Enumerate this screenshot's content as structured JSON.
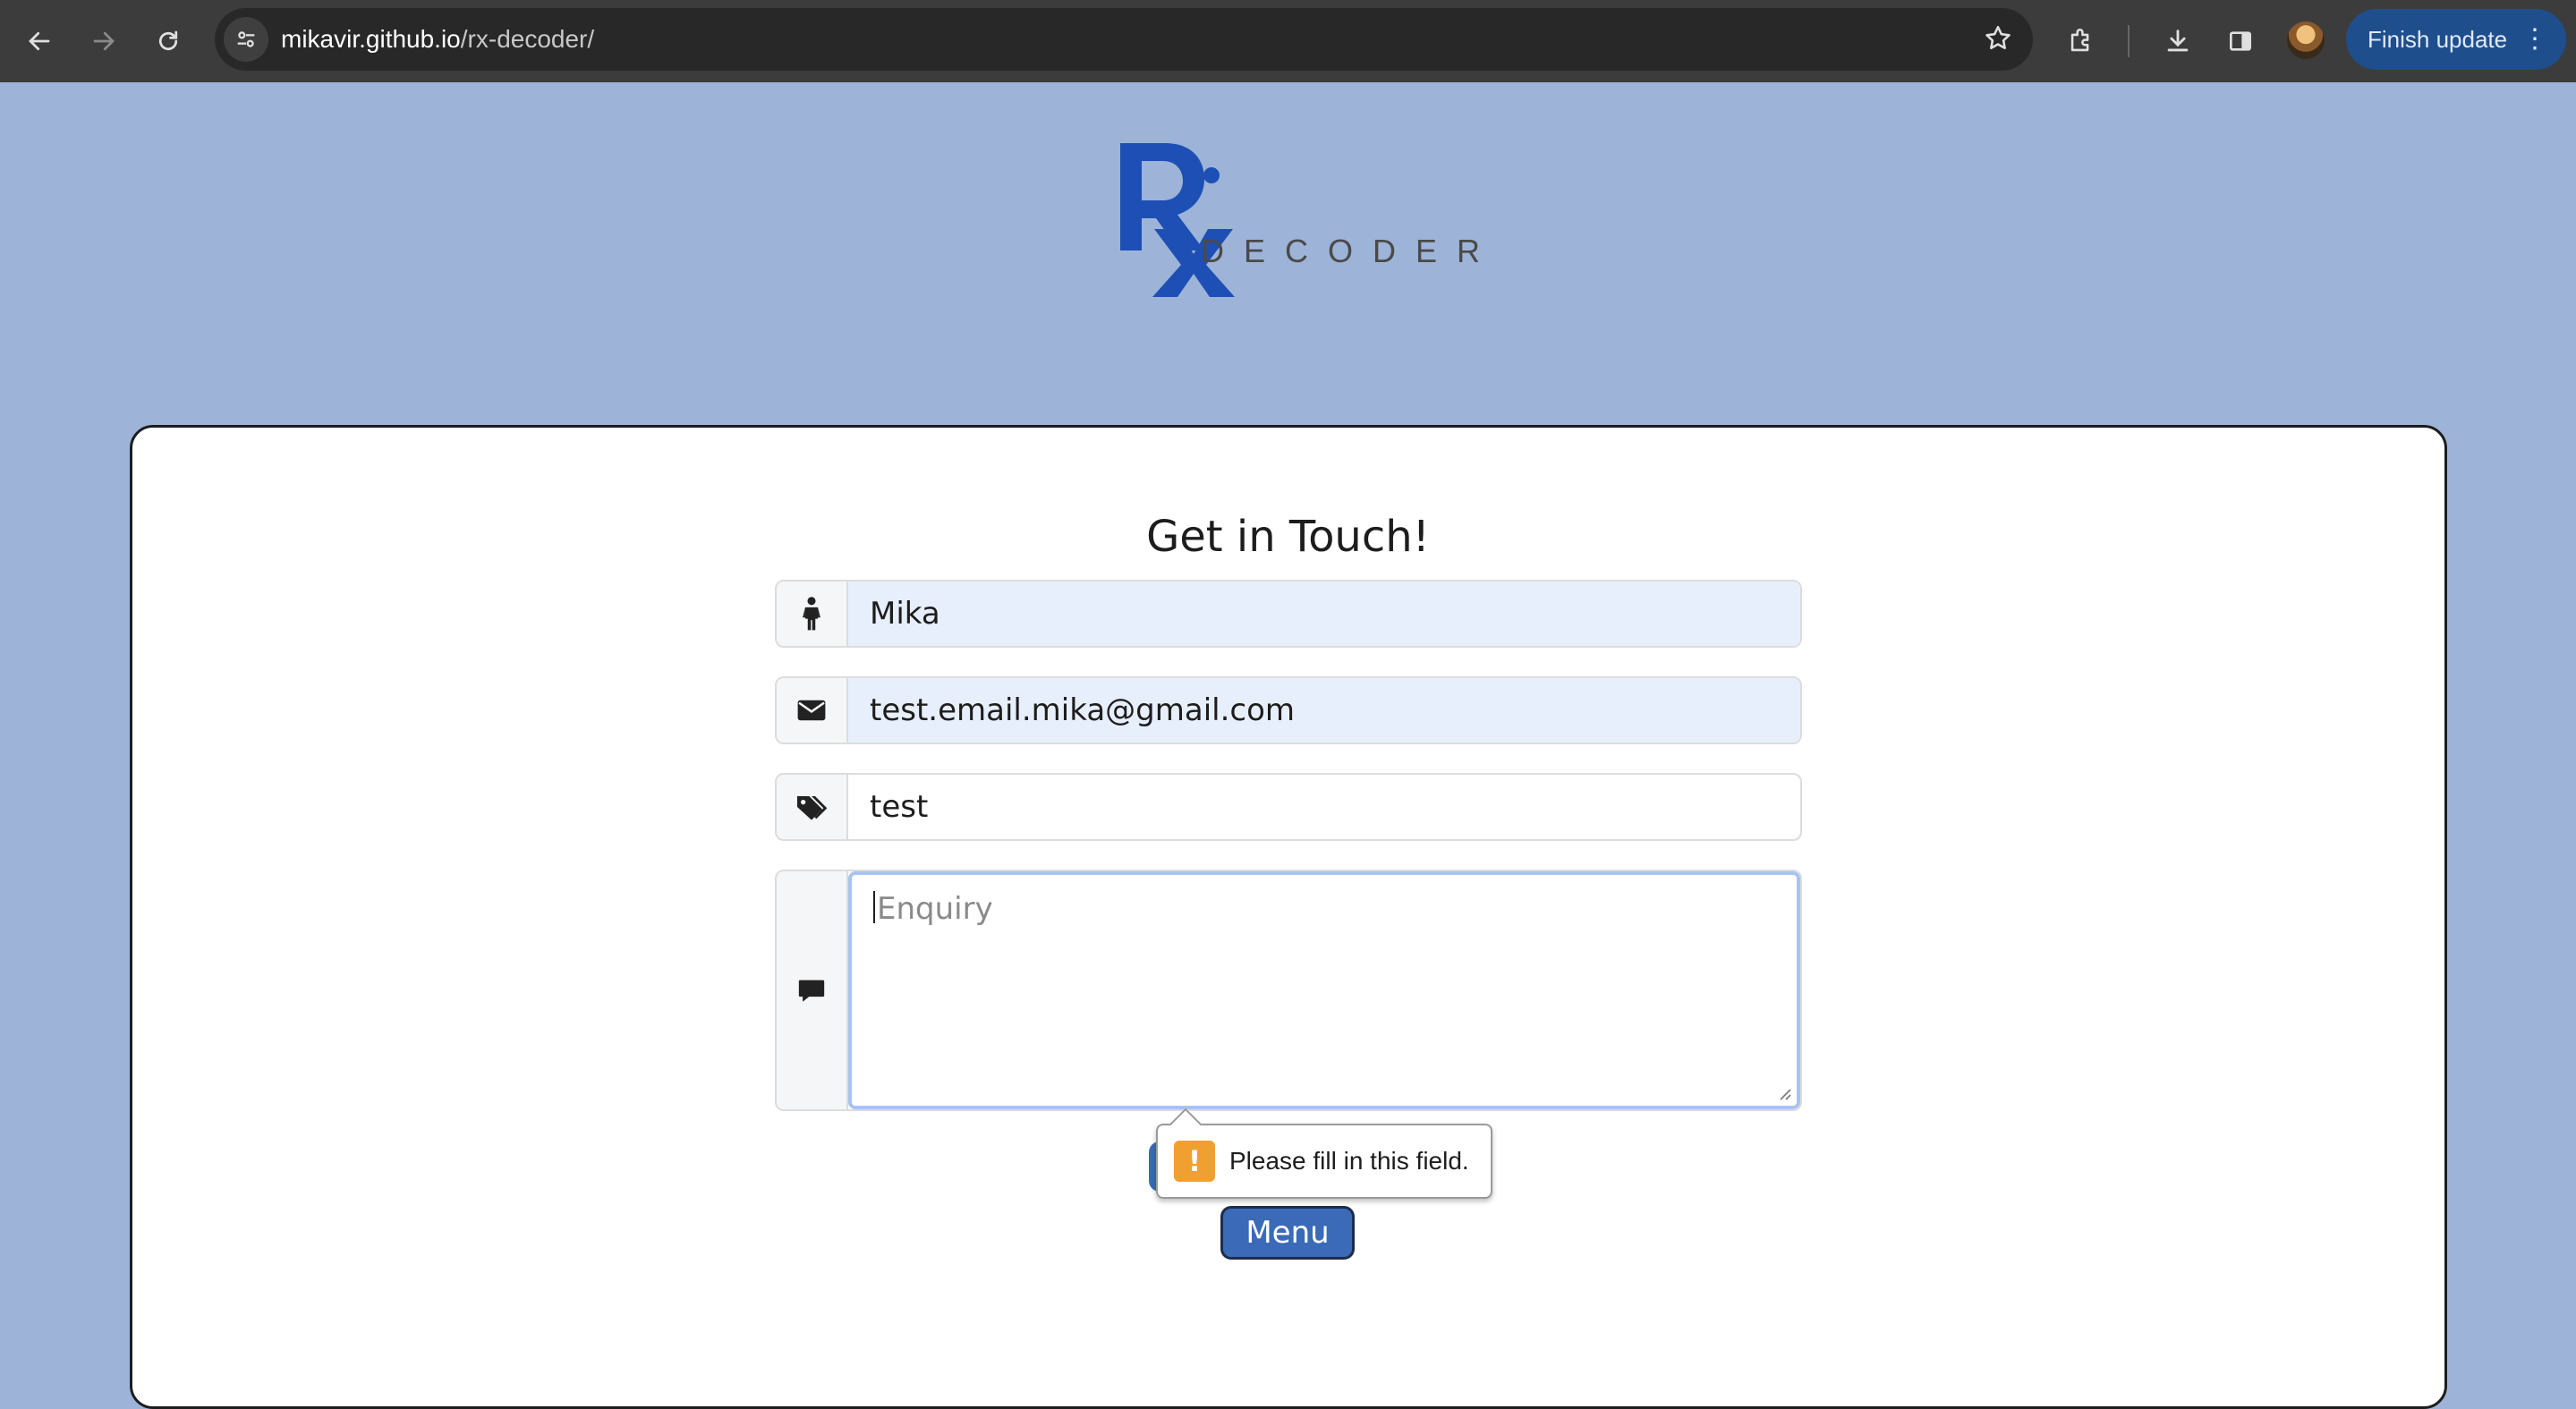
{
  "browser": {
    "url_host": "mikavir.github.io",
    "url_path": "/rx-decoder/",
    "finish_update_label": "Finish update",
    "icons": {
      "back": "back-arrow-icon",
      "forward": "forward-arrow-icon",
      "reload": "reload-icon",
      "site_info": "tune-icon",
      "bookmark": "star-icon",
      "extensions": "puzzle-icon",
      "downloads": "download-icon",
      "side_panel": "side-panel-icon",
      "profile": "avatar",
      "menu": "kebab-menu-icon"
    }
  },
  "logo": {
    "wordmark": "DECODER",
    "brand_color": "#1d4fb4"
  },
  "form": {
    "title": "Get in Touch!",
    "name_value": "Mika",
    "email_value": "test.email.mika@gmail.com",
    "subject_value": "test",
    "enquiry_placeholder": "Enquiry",
    "icons": {
      "name": "person-icon",
      "email": "envelope-icon",
      "subject": "tags-icon",
      "enquiry": "chat-bubble-icon"
    }
  },
  "validation": {
    "message": "Please fill in this field.",
    "icon": "warning-icon"
  },
  "buttons": {
    "menu_label": "Menu"
  },
  "colors": {
    "page_bg": "#9db4d8",
    "button_bg": "#3a6ab8",
    "autofill_bg": "#e8effc",
    "warning": "#f0a030"
  }
}
